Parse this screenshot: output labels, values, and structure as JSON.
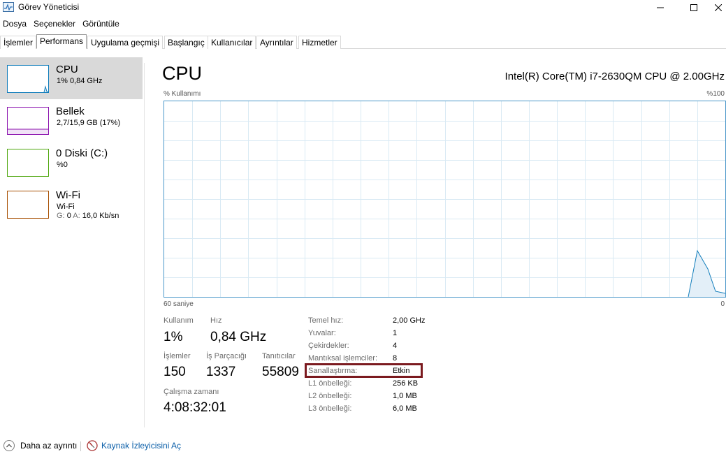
{
  "window": {
    "title": "Görev Yöneticisi",
    "icon": "task-manager-icon",
    "controls": {
      "minimize": "—",
      "maximize": "☐",
      "close": "✕"
    }
  },
  "menu": [
    "Dosya",
    "Seçenekler",
    "Görüntüle"
  ],
  "tabs": [
    "İşlemler",
    "Performans",
    "Uygulama geçmişi",
    "Başlangıç",
    "Kullanıcılar",
    "Ayrıntılar",
    "Hizmetler"
  ],
  "active_tab": "Performans",
  "sidebar": {
    "items": [
      {
        "title": "CPU",
        "sub": "1% 0,84 GHz",
        "color": "#117dbb",
        "selected": true
      },
      {
        "title": "Bellek",
        "sub": "2,7/15,9 GB (17%)",
        "color": "#8b12ae",
        "selected": false
      },
      {
        "title": "0 Diski (C:)",
        "sub": "%0",
        "color": "#4da60c",
        "selected": false
      },
      {
        "title": "Wi-Fi",
        "sub": "Wi-Fi",
        "sub2_send": "G:",
        "sub2_send_val": "0",
        "sub2_recv": "A:",
        "sub2_recv_val": "16,0 Kb/sn",
        "color": "#a74f01",
        "selected": false
      }
    ]
  },
  "main": {
    "title": "CPU",
    "model": "Intel(R) Core(TM) i7-2630QM CPU @ 2.00GHz",
    "usage_label": "% Kullanımı",
    "usage_max": "%100",
    "time_left": "60 saniye",
    "time_right": "0",
    "stats": {
      "usage_label": "Kullanım",
      "usage_value": "1%",
      "speed_label": "Hız",
      "speed_value": "0,84 GHz",
      "processes_label": "İşlemler",
      "processes_value": "150",
      "threads_label": "İş Parçacığı",
      "threads_value": "1337",
      "handles_label": "Tanıtıcılar",
      "handles_value": "55809",
      "uptime_label": "Çalışma zamanı",
      "uptime_value": "4:08:32:01"
    },
    "specs": [
      {
        "label": "Temel hız:",
        "value": "2,00 GHz"
      },
      {
        "label": "Yuvalar:",
        "value": "1"
      },
      {
        "label": "Çekirdekler:",
        "value": "4"
      },
      {
        "label": "Mantıksal işlemciler:",
        "value": "8"
      },
      {
        "label": "Sanallaştırma:",
        "value": "Etkin"
      },
      {
        "label": "L1 önbelleği:",
        "value": "256 KB"
      },
      {
        "label": "L2 önbelleği:",
        "value": "1,0 MB"
      },
      {
        "label": "L3 önbelleği:",
        "value": "6,0 MB"
      }
    ],
    "graph_color": "#117dbb",
    "highlight_color": "#7b1a1f"
  },
  "footer": {
    "less_details": "Daha az ayrıntı",
    "resource_monitor": "Kaynak İzleyicisini Aç"
  }
}
